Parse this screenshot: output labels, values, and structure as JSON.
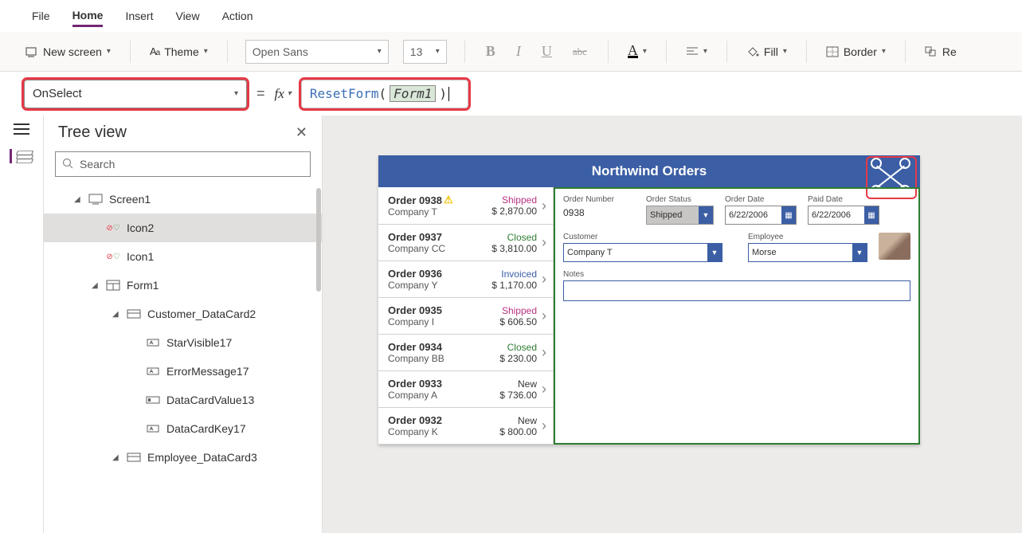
{
  "menu": {
    "file": "File",
    "home": "Home",
    "insert": "Insert",
    "view": "View",
    "action": "Action"
  },
  "ribbon": {
    "newScreen": "New screen",
    "theme": "Theme",
    "font": "Open Sans",
    "size": "13",
    "fill": "Fill",
    "border": "Border",
    "reorder": "Re"
  },
  "formula": {
    "property": "OnSelect",
    "fxLabel": "fx",
    "fn": "ResetForm",
    "paren_open": "(",
    "param": "Form1",
    "paren_close": ")"
  },
  "tree": {
    "title": "Tree view",
    "searchPlaceholder": "Search",
    "items": [
      {
        "label": "Screen1",
        "depth": 1,
        "iconType": "screen",
        "caret": true
      },
      {
        "label": "Icon2",
        "depth": 2,
        "iconType": "icon",
        "caret": false,
        "selected": true
      },
      {
        "label": "Icon1",
        "depth": 2,
        "iconType": "icon",
        "caret": false
      },
      {
        "label": "Form1",
        "depth": 2,
        "iconType": "form",
        "caret": true
      },
      {
        "label": "Customer_DataCard2",
        "depth": 3,
        "iconType": "card",
        "caret": true
      },
      {
        "label": "StarVisible17",
        "depth": 4,
        "iconType": "label"
      },
      {
        "label": "ErrorMessage17",
        "depth": 4,
        "iconType": "label"
      },
      {
        "label": "DataCardValue13",
        "depth": 4,
        "iconType": "input"
      },
      {
        "label": "DataCardKey17",
        "depth": 4,
        "iconType": "label"
      },
      {
        "label": "Employee_DataCard3",
        "depth": 3,
        "iconType": "card",
        "caret": true
      }
    ]
  },
  "app": {
    "title": "Northwind Orders",
    "orders": [
      {
        "num": "Order 0938",
        "warn": true,
        "company": "Company T",
        "status": "Shipped",
        "statusClass": "st-shipped",
        "amount": "$ 2,870.00"
      },
      {
        "num": "Order 0937",
        "company": "Company CC",
        "status": "Closed",
        "statusClass": "st-closed",
        "amount": "$ 3,810.00"
      },
      {
        "num": "Order 0936",
        "company": "Company Y",
        "status": "Invoiced",
        "statusClass": "st-invoiced",
        "amount": "$ 1,170.00"
      },
      {
        "num": "Order 0935",
        "company": "Company I",
        "status": "Shipped",
        "statusClass": "st-shipped",
        "amount": "$ 606.50"
      },
      {
        "num": "Order 0934",
        "company": "Company BB",
        "status": "Closed",
        "statusClass": "st-closed",
        "amount": "$ 230.00"
      },
      {
        "num": "Order 0933",
        "company": "Company A",
        "status": "New",
        "statusClass": "st-new",
        "amount": "$ 736.00"
      },
      {
        "num": "Order 0932",
        "company": "Company K",
        "status": "New",
        "statusClass": "st-new",
        "amount": "$ 800.00"
      }
    ],
    "form": {
      "orderNumberLabel": "Order Number",
      "orderNumber": "0938",
      "orderStatusLabel": "Order Status",
      "orderStatus": "Shipped",
      "orderDateLabel": "Order Date",
      "orderDate": "6/22/2006",
      "paidDateLabel": "Paid Date",
      "paidDate": "6/22/2006",
      "customerLabel": "Customer",
      "customer": "Company T",
      "employeeLabel": "Employee",
      "employee": "Morse",
      "notesLabel": "Notes"
    }
  }
}
